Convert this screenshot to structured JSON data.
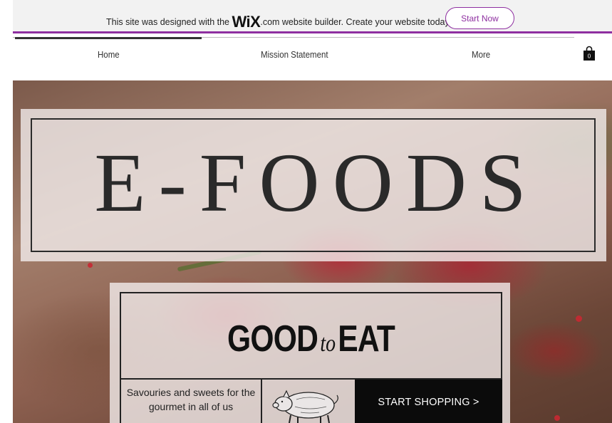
{
  "banner": {
    "text_before": "This site was designed with the ",
    "wix_logo": "WiX",
    "text_after": ".com website builder. Create your website today.",
    "button_label": "Start Now",
    "accent_color": "#8e2fa0"
  },
  "nav": {
    "items": [
      {
        "label": "Home"
      },
      {
        "label": "Mission Statement"
      },
      {
        "label": "More"
      }
    ],
    "cart_icon": "shopping-bag-icon",
    "cart_count": "0"
  },
  "hero": {
    "title": "E-FOODS",
    "headline_left": "GOOD",
    "headline_script": "to",
    "headline_right": "EAT",
    "tagline": "Savouries and sweets for the gourmet in all of us",
    "pig_icon": "pig-illustration",
    "cta_label": "START SHOPPING >"
  }
}
